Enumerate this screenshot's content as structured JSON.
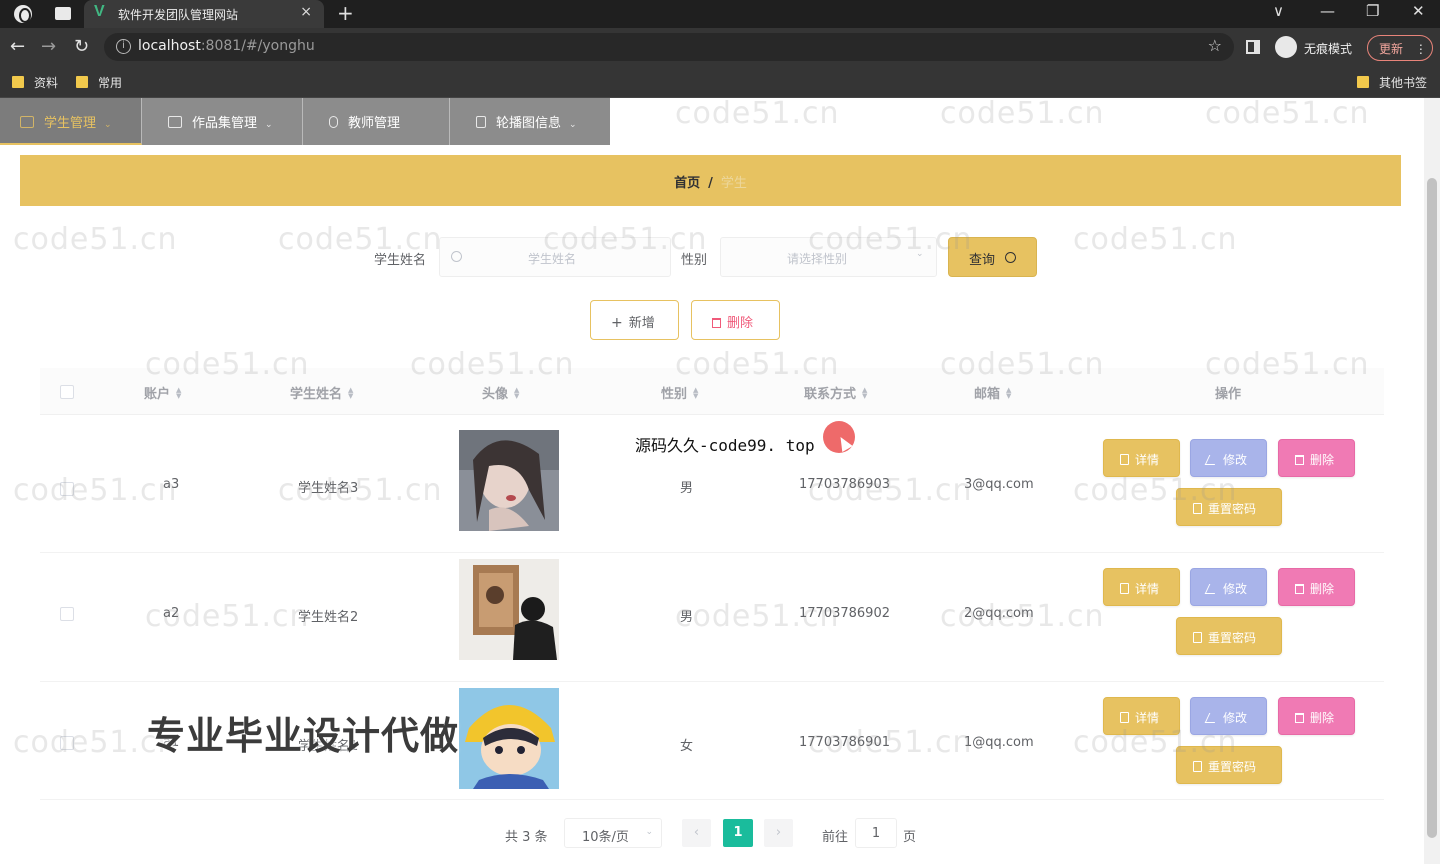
{
  "browser": {
    "tab_title": "软件开发团队管理网站",
    "tab_logo": "V",
    "tab_close": "×",
    "new_tab": "+",
    "url_host": "localhost",
    "url_rest": ":8081/#/yonghu",
    "incognito_label": "无痕模式",
    "update_label": "更新",
    "bookmarks": [
      "资料",
      "常用"
    ],
    "other_bookmarks": "其他书签",
    "window_controls": [
      "∨",
      "—",
      "❐",
      "✕"
    ]
  },
  "topnav": [
    {
      "label": "学生管理",
      "icon": "user-icon",
      "active": true
    },
    {
      "label": "作品集管理",
      "icon": "grid-icon",
      "active": false
    },
    {
      "label": "教师管理",
      "icon": "mic-icon",
      "active": false
    },
    {
      "label": "轮播图信息",
      "icon": "flag-icon",
      "active": false
    }
  ],
  "breadcrumb": {
    "home": "首页",
    "sep": "/",
    "current": "学生"
  },
  "search": {
    "name_label": "学生姓名",
    "name_placeholder": "学生姓名",
    "gender_label": "性别",
    "gender_placeholder": "请选择性别",
    "query_label": "查询"
  },
  "actions": {
    "add_label": "新增",
    "delete_label": "删除"
  },
  "table": {
    "headers": {
      "account": "账户",
      "name": "学生姓名",
      "avatar": "头像",
      "gender": "性别",
      "phone": "联系方式",
      "email": "邮箱",
      "ops": "操作"
    },
    "rows": [
      {
        "account": "a3",
        "name": "学生姓名3",
        "gender": "男",
        "phone": "17703786903",
        "email": "3@qq.com"
      },
      {
        "account": "a2",
        "name": "学生姓名2",
        "gender": "男",
        "phone": "17703786902",
        "email": "2@qq.com"
      },
      {
        "account": "a1",
        "name": "学生姓名1",
        "gender": "女",
        "phone": "17703786901",
        "email": "1@qq.com"
      }
    ],
    "row_buttons": {
      "detail": "详情",
      "edit": "修改",
      "remove": "删除",
      "reset": "重置密码"
    }
  },
  "pagination": {
    "total": "共 3 条",
    "page_size": "10条/页",
    "current": "1",
    "goto_label": "前往",
    "goto_value": "1",
    "page_suffix": "页",
    "prev": "‹",
    "next": "›"
  },
  "overlays": {
    "source_text": "源码久久-code99. top",
    "promo_text": "专业毕业设计代做",
    "watermark": "code51.cn"
  },
  "colors": {
    "accent": "#e7c261",
    "edit": "#a9b4ea",
    "delete": "#f07ab4",
    "pager_active": "#1abc9c",
    "nav_bg": "#8c8c8c"
  }
}
